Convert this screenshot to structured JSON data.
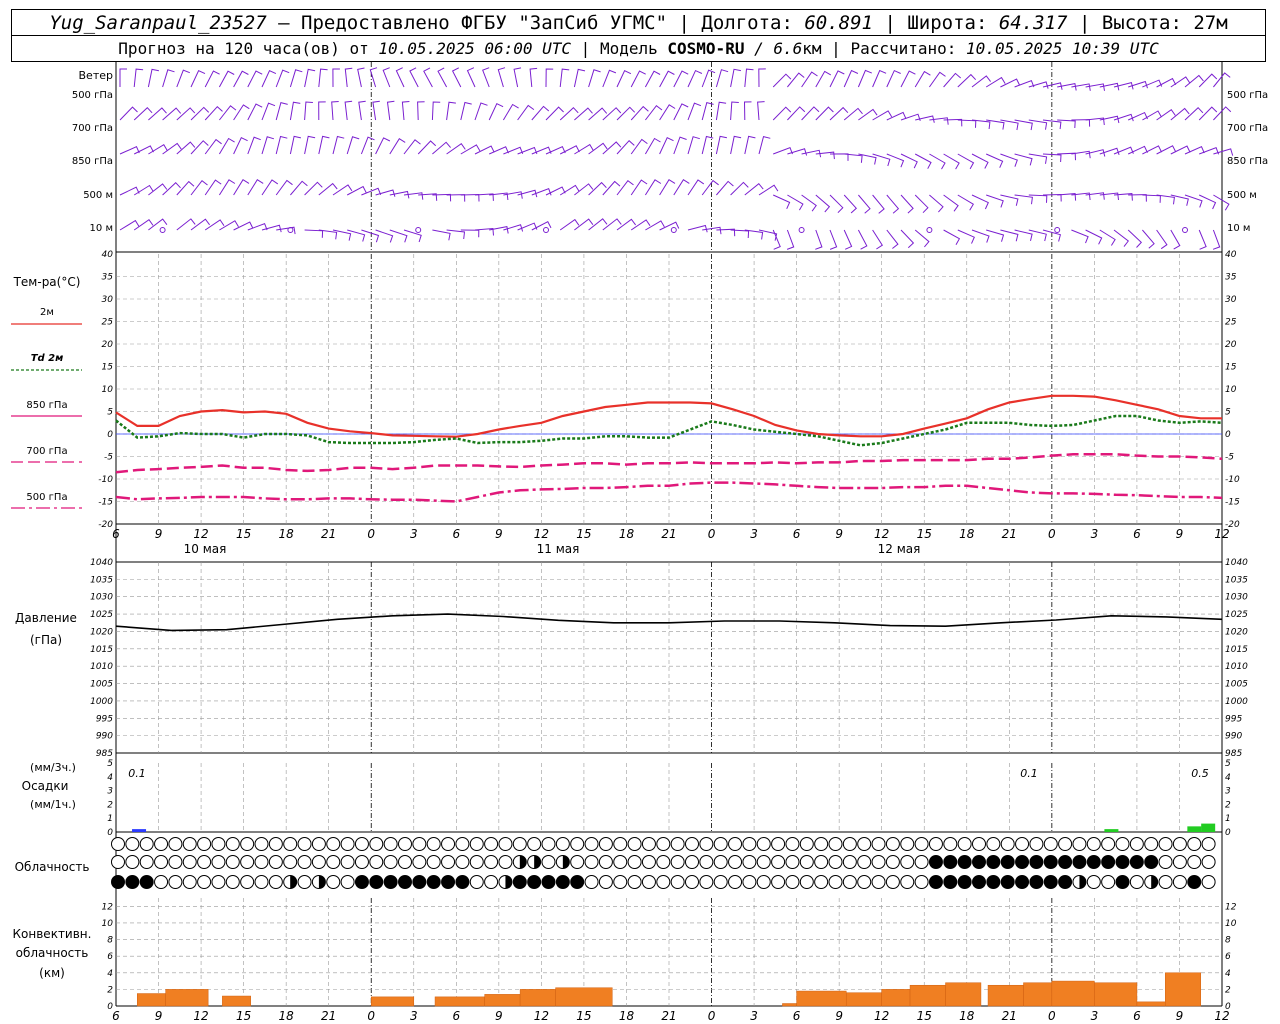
{
  "header": {
    "station": "Yug_Saranpaul_23527",
    "dash": "–",
    "provider": "Предоставлено ФГБУ \"ЗапСиб УГМС\"",
    "lon_label": "Долгота:",
    "lon_value": "60.891",
    "lat_label": "Широта:",
    "lat_value": "64.317",
    "alt_label": "Высота:",
    "alt_value": "27м",
    "forecast_label": "Прогноз на 120 часа(ов) от",
    "forecast_from": "10.05.2025 06:00 UTC",
    "model_label": "Модель",
    "model_name": "COSMO-RU",
    "model_res": "/ 6.6",
    "model_res_unit": "км",
    "calc_label": "Рассчитано:",
    "calc_time": "10.05.2025 10:39 UTC"
  },
  "wind": {
    "title": "Ветер",
    "levels": [
      "500 гПа",
      "700 гПа",
      "850 гПа",
      "500 м",
      "10  м"
    ],
    "color": "#7a1fd0"
  },
  "temperature": {
    "title": "Тем-ра(°С)",
    "legend": [
      {
        "label": "2м",
        "color": "#e8312a",
        "dash": "solid"
      },
      {
        "label": "Td  2м",
        "color": "#1a7a1a",
        "dash": "dotted"
      },
      {
        "label": "850 гПа",
        "color": "#e0187a",
        "dash": "solid"
      },
      {
        "label": "700 гПа",
        "color": "#e0187a",
        "dash": "dashed"
      },
      {
        "label": "500 гПа",
        "color": "#e0187a",
        "dash": "dashdot"
      }
    ],
    "ticks": [
      "40",
      "35",
      "30",
      "25",
      "20",
      "15",
      "10",
      "5",
      "0",
      "-5",
      "-10",
      "-15",
      "-20"
    ]
  },
  "pressure": {
    "title": "Давление",
    "unit": "(гПа)",
    "ticks": [
      "1040",
      "1035",
      "1030",
      "1025",
      "1020",
      "1015",
      "1010",
      "1005",
      "1000",
      "995",
      "990",
      "985"
    ]
  },
  "precip": {
    "unit3": "(мм/3ч.)",
    "title": "Осадки",
    "unit1": "(мм/1ч.)",
    "ticks": [
      "5",
      "4",
      "3",
      "2",
      "1",
      "0"
    ],
    "labels": [
      "0.1",
      "0.1",
      "0.5"
    ]
  },
  "clouds": {
    "title": "Облачность"
  },
  "convective": {
    "title1": "Конвективн.",
    "title2": "облачность",
    "unit": "(км)",
    "ticks": [
      "12",
      "10",
      "8",
      "6",
      "4",
      "2",
      "0"
    ]
  },
  "time_axis": {
    "hour_labels": [
      "6",
      "9",
      "12",
      "15",
      "18",
      "21",
      "0",
      "3",
      "6",
      "9",
      "12",
      "15",
      "18",
      "21",
      "0",
      "3",
      "6",
      "9",
      "12",
      "15",
      "18",
      "21",
      "0",
      "3",
      "6",
      "9",
      "12"
    ],
    "day_labels": [
      "10 мая",
      "11 мая",
      "12 мая"
    ]
  },
  "chart_data": [
    {
      "type": "line",
      "title": "Тем-ра(°С)",
      "x_hours_from_start": [
        0,
        1.5,
        3,
        4.5,
        6,
        7.5,
        9,
        10.5,
        12,
        13.5,
        15,
        16.5,
        18,
        19.5,
        21,
        22.5,
        24,
        25.5,
        27,
        28.5,
        30,
        31.5,
        33,
        34.5,
        36,
        37.5,
        39,
        40.5,
        42,
        43.5,
        45,
        46.5,
        48,
        49.5,
        51,
        52.5,
        54,
        55.5,
        57,
        58.5,
        60,
        61.5,
        63,
        64.5,
        66,
        67.5,
        69,
        70.5,
        72,
        73.5,
        75,
        76.5,
        78
      ],
      "ylim": [
        -20,
        40
      ],
      "series": [
        {
          "name": "2м",
          "values": [
            4.8,
            1.8,
            1.8,
            4,
            5,
            5.3,
            4.8,
            5,
            4.5,
            2.5,
            1.2,
            0.6,
            0.2,
            -0.3,
            -0.4,
            -0.5,
            -0.6,
            0,
            1,
            1.8,
            2.5,
            4,
            5,
            6,
            6.5,
            7,
            7,
            7,
            6.8,
            5.5,
            4,
            2,
            0.8,
            0,
            -0.3,
            -0.5,
            -0.5,
            0,
            1.2,
            2.3,
            3.5,
            5.5,
            7,
            7.8,
            8.5,
            8.5,
            8.3,
            7.5,
            6.5,
            5.5,
            4,
            3.5,
            3.5
          ]
        },
        {
          "name": "Td  2м",
          "values": [
            3,
            -0.8,
            -0.5,
            0.2,
            0,
            0,
            -0.8,
            0,
            0,
            -0.3,
            -1.8,
            -2,
            -2,
            -2,
            -1.8,
            -1.3,
            -1,
            -2,
            -1.8,
            -1.8,
            -1.5,
            -1,
            -1,
            -0.5,
            -0.5,
            -0.8,
            -0.8,
            1,
            2.8,
            2,
            1,
            0.5,
            0,
            -0.5,
            -1.5,
            -2.5,
            -2,
            -1,
            0,
            1,
            2.5,
            2.5,
            2.5,
            2,
            1.8,
            2,
            3,
            4,
            4,
            3,
            2.5,
            2.8,
            2.5
          ]
        },
        {
          "name": "850 гПа",
          "values": [
            -8.5,
            -8,
            -7.8,
            -7.5,
            -7.3,
            -7,
            -7.5,
            -7.5,
            -8,
            -8.2,
            -8,
            -7.5,
            -7.5,
            -7.8,
            -7.5,
            -7,
            -7,
            -7,
            -7.2,
            -7.3,
            -7,
            -6.8,
            -6.5,
            -6.5,
            -6.8,
            -6.5,
            -6.5,
            -6.3,
            -6.5,
            -6.5,
            -6.5,
            -6.3,
            -6.5,
            -6.3,
            -6.3,
            -6,
            -6,
            -5.8,
            -5.8,
            -5.8,
            -5.8,
            -5.5,
            -5.5,
            -5.2,
            -4.8,
            -4.5,
            -4.5,
            -4.5,
            -4.8,
            -5,
            -5,
            -5.2,
            -5.5
          ]
        },
        {
          "name": "700 гПа",
          "values": [
            -14,
            -14.5,
            -14.3,
            -14.2,
            -14,
            -14,
            -14,
            -14.3,
            -14.5,
            -14.5,
            -14.3,
            -14.3,
            -14.5,
            -14.6,
            -14.6,
            -14.8,
            -15,
            -14,
            -13,
            -12.5,
            -12.3,
            -12.2,
            -12,
            -12,
            -11.8,
            -11.5,
            -11.5,
            -11,
            -10.8,
            -10.8,
            -11,
            -11.2,
            -11.5,
            -11.8,
            -12,
            -12,
            -12,
            -11.8,
            -11.8,
            -11.5,
            -11.5,
            -12,
            -12.5,
            -13,
            -13.2,
            -13.2,
            -13.3,
            -13.5,
            -13.6,
            -13.8,
            -14,
            -14,
            -14.2
          ]
        }
      ]
    },
    {
      "type": "line",
      "title": "Давление",
      "x_hours_from_start": [
        0,
        6,
        12,
        18,
        24,
        30,
        36,
        42,
        48,
        54,
        60,
        66,
        72,
        78,
        84,
        90,
        96,
        102,
        108,
        114,
        120
      ],
      "ylim": [
        985,
        1040
      ],
      "series": [
        {
          "name": "Давление",
          "values": [
            1021.5,
            1020.3,
            1020.5,
            1022,
            1023.5,
            1024.5,
            1025,
            1024.3,
            1023.2,
            1022.5,
            1022.5,
            1023,
            1023,
            1022.5,
            1021.7,
            1021.5,
            1022.5,
            1023.3,
            1024.5,
            1024.2,
            1023.5
          ]
        }
      ]
    },
    {
      "type": "bar",
      "title": "Осадки",
      "x_hours_from_start": [
        2.5,
        108,
        117,
        118.5
      ],
      "values": [
        0.1,
        0.1,
        0.3,
        0.5
      ],
      "ylim": [
        0,
        5
      ]
    }
  ]
}
